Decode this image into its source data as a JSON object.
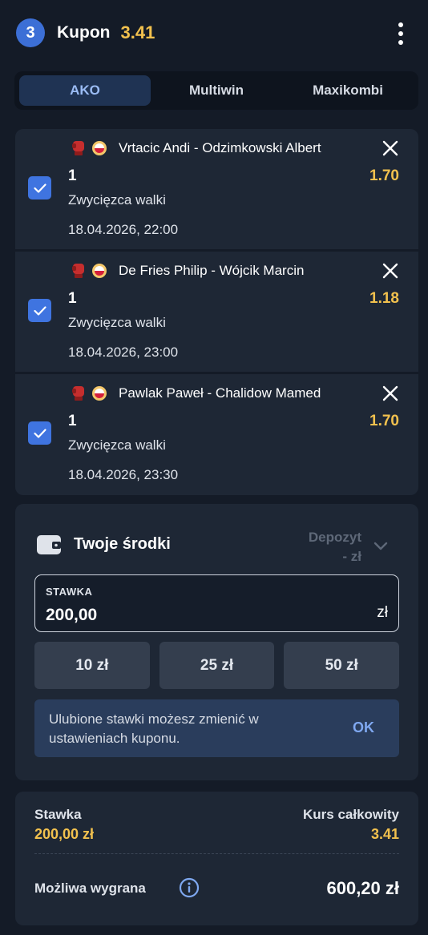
{
  "header": {
    "count": "3",
    "title": "Kupon",
    "total_odds": "3.41",
    "menu_icon": "more-vertical-icon"
  },
  "tabs": [
    {
      "label": "AKO",
      "active": true
    },
    {
      "label": "Multiwin",
      "active": false
    },
    {
      "label": "Maxikombi",
      "active": false
    }
  ],
  "bets": [
    {
      "match": "Vrtacic Andi - Odzimkowski Albert",
      "pick": "1",
      "odds": "1.70",
      "market": "Zwycięzca walki",
      "datetime": "18.04.2026, 22:00",
      "checked": true
    },
    {
      "match": "De Fries Philip - Wójcik Marcin",
      "pick": "1",
      "odds": "1.18",
      "market": "Zwycięzca walki",
      "datetime": "18.04.2026, 23:00",
      "checked": true
    },
    {
      "match": "Pawlak Paweł - Chalidow Mamed",
      "pick": "1",
      "odds": "1.70",
      "market": "Zwycięzca walki",
      "datetime": "18.04.2026, 23:30",
      "checked": true
    }
  ],
  "funds": {
    "title": "Twoje środki",
    "deposit_line1": "Depozyt",
    "deposit_line2": "- zł",
    "stake_label": "STAWKA",
    "stake_value": "200,00",
    "stake_currency": "zł",
    "quick_stakes": [
      "10 zł",
      "25 zł",
      "50 zł"
    ],
    "info_text": "Ulubione stawki możesz zmienić w ustawieniach kuponu.",
    "info_ok": "OK"
  },
  "summary": {
    "stake_label": "Stawka",
    "stake_value": "200,00 zł",
    "odds_label": "Kurs całkowity",
    "odds_value": "3.41",
    "win_label": "Możliwa wygrana",
    "win_value": "600,20 zł"
  },
  "colors": {
    "background": "#141b27",
    "card": "#1e2735",
    "accent_blue": "#3f74e0",
    "odds_gold": "#f2c14e"
  }
}
